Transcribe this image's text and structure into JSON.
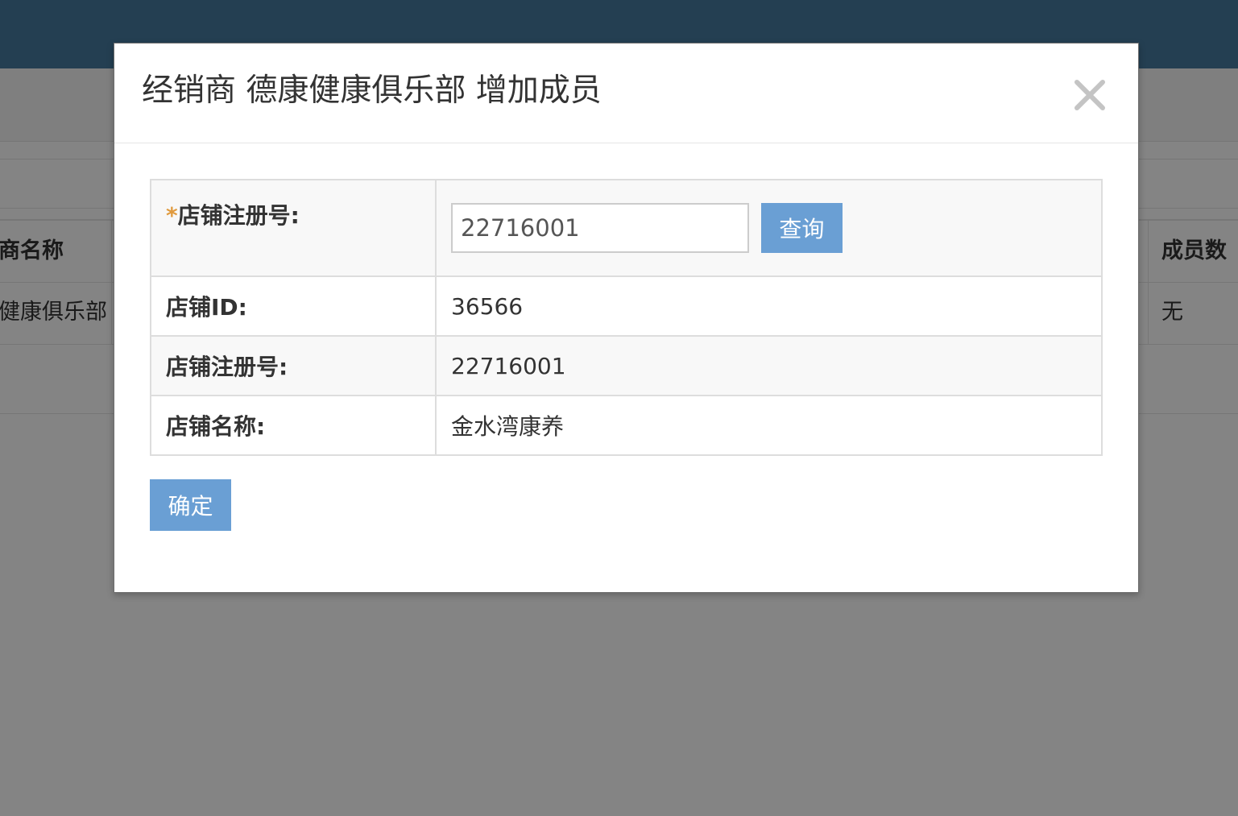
{
  "background": {
    "table_header": {
      "name_col": "商名称",
      "count_col": "成员数"
    },
    "table_row": {
      "name": "健康俱乐部",
      "count": "无"
    }
  },
  "modal": {
    "title": "经销商 德康健康俱乐部 增加成员",
    "close_symbol": "×",
    "form": {
      "reg_label_star": "*",
      "reg_label": "店铺注册号:",
      "reg_input_value": "22716001",
      "query_label": "查询"
    },
    "rows": [
      {
        "label": "店铺ID:",
        "value": "36566"
      },
      {
        "label": "店铺注册号:",
        "value": "22716001"
      },
      {
        "label": "店铺名称:",
        "value": "金水湾康养"
      }
    ],
    "confirm_label": "确定"
  },
  "colors": {
    "topbar": "#243f52",
    "overlay": "#848484",
    "primary_button": "#6a9fd4",
    "required_star": "#e09a3e"
  },
  "icons": {
    "close": "close-icon"
  }
}
